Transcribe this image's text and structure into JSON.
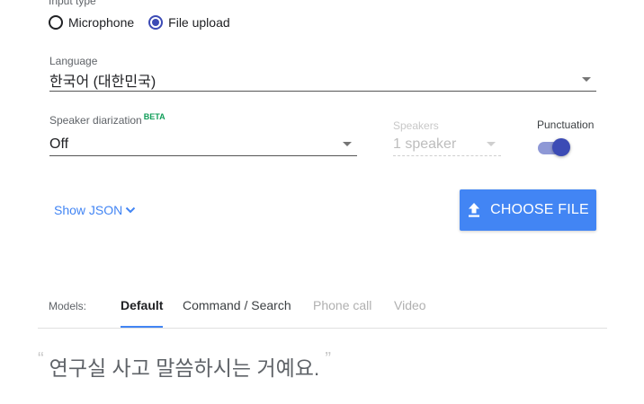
{
  "input_type": {
    "label": "Input type",
    "options": [
      {
        "label": "Microphone",
        "checked": false
      },
      {
        "label": "File upload",
        "checked": true
      }
    ]
  },
  "language": {
    "label": "Language",
    "value": "한국어 (대한민국)"
  },
  "diarization": {
    "label": "Speaker diarization",
    "badge": "BETA",
    "value": "Off"
  },
  "speakers": {
    "label": "Speakers",
    "value": "1 speaker",
    "disabled": true
  },
  "punctuation": {
    "label": "Punctuation",
    "enabled": true
  },
  "show_json": {
    "label": "Show JSON",
    "icon": "chevron-down-icon"
  },
  "choose_file": {
    "label": "CHOOSE FILE",
    "icon": "upload-icon"
  },
  "models": {
    "label": "Models:",
    "tabs": [
      {
        "label": "Default",
        "state": "active"
      },
      {
        "label": "Command / Search",
        "state": "enabled"
      },
      {
        "label": "Phone call",
        "state": "disabled"
      },
      {
        "label": "Video",
        "state": "disabled"
      }
    ]
  },
  "transcript": {
    "open_quote": "“",
    "text": "연구실 사고 말씀하시는 거예요.",
    "close_quote": "”"
  },
  "colors": {
    "accent": "#4285f4",
    "toggle": "#3c4bb5",
    "beta": "#0f9d58"
  }
}
